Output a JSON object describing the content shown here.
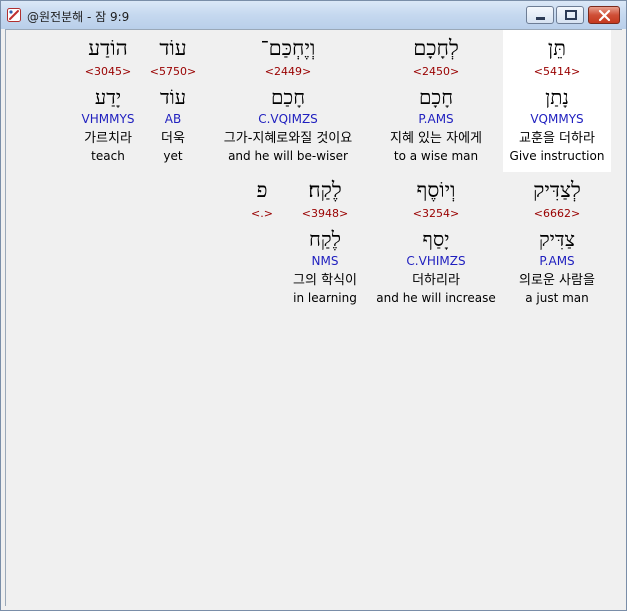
{
  "window": {
    "title": "@원전분해 - 잠 9:9",
    "icon": "scroll-app-icon",
    "controls": [
      "minimize",
      "maximize",
      "close"
    ]
  },
  "row1": [
    {
      "hebrew": "תֵּן",
      "strong": "<5414>",
      "lemma": "נָתַן",
      "parse": "VQMMYS",
      "korean": "교훈을 더하라",
      "english": "Give instruction",
      "selected": true
    },
    {
      "hebrew": "לְחָכָם",
      "strong": "<2450>",
      "lemma": "חָכָם",
      "parse": "P.AMS",
      "korean": "지혜 있는 자에게",
      "english": "to a wise man"
    },
    {
      "hebrew": "וְיֶחְכַּם־",
      "strong": "<2449>",
      "lemma": "חָכַם",
      "parse": "C.VQIMZS",
      "korean": "그가-지혜로와질 것이요",
      "english": "and he will be-wiser"
    },
    {
      "hebrew": "עוֹד",
      "strong": "<5750>",
      "lemma": "עוֹד",
      "parse": "AB",
      "korean": "더욱",
      "english": "yet"
    },
    {
      "hebrew": "הוֹדַע",
      "strong": "<3045>",
      "lemma": "יָדַע",
      "parse": "VHMMYS",
      "korean": "가르치라",
      "english": "teach"
    }
  ],
  "row2": [
    {
      "hebrew": "לְצַדִּיק",
      "strong": "<6662>",
      "lemma": "צַדִּיק",
      "parse": "P.AMS",
      "korean": "의로운 사람을",
      "english": "a just man"
    },
    {
      "hebrew": "וְיוֹסֶף",
      "strong": "<3254>",
      "lemma": "יָסַף",
      "parse": "C.VHIMZS",
      "korean": "더하리라",
      "english": "and he will increase"
    },
    {
      "hebrew": "לֶקַח׃",
      "strong": "<3948>",
      "lemma": "לֶקַח",
      "parse": "NMS",
      "korean": "그의 학식이",
      "english": "in learning"
    },
    {
      "hebrew": "פ",
      "strong": "<.>"
    }
  ]
}
